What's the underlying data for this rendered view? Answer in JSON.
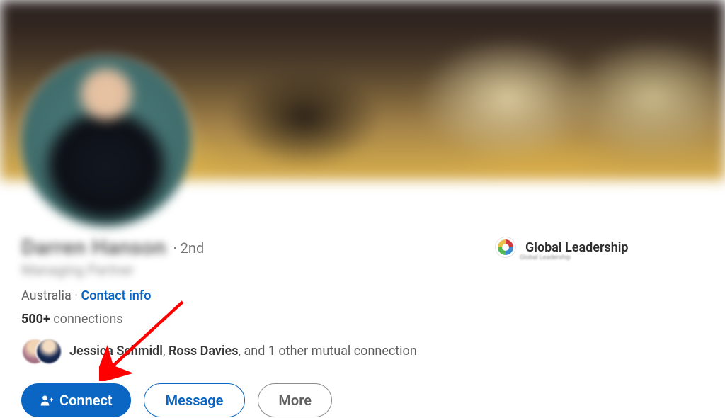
{
  "profile": {
    "name_blurred": "Darren Hanson",
    "degree": "· 2nd",
    "title_blurred": "Managing Partner",
    "location": "Australia",
    "separator": " · ",
    "contact_label": "Contact info",
    "connections_count": "500+",
    "connections_word": " connections"
  },
  "mutual": {
    "name1": "Jessica Schmidl",
    "comma": ", ",
    "name2": "Ross Davies",
    "rest": ", and 1 other mutual connection"
  },
  "buttons": {
    "connect": "Connect",
    "message": "Message",
    "more": "More"
  },
  "company": {
    "name": "Global Leadership",
    "subtext": "Global Leadership"
  }
}
